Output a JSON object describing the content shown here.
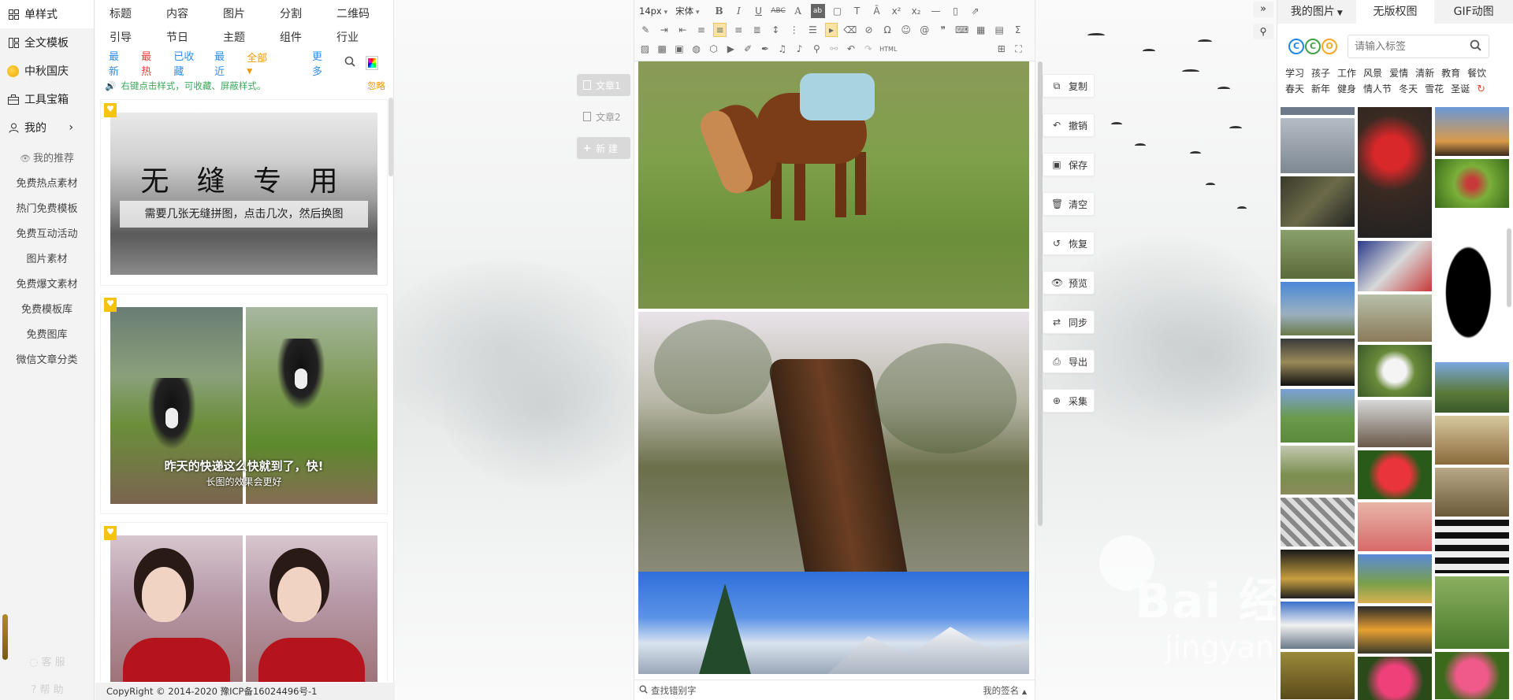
{
  "left_nav": {
    "main": [
      {
        "label": "单样式",
        "icon": "grid-icon",
        "active": true
      },
      {
        "label": "全文模板",
        "icon": "template-icon"
      },
      {
        "label": "中秋国庆",
        "icon": "moon-icon"
      },
      {
        "label": "工具宝箱",
        "icon": "toolbox-icon"
      },
      {
        "label": "我的",
        "icon": "user-icon"
      }
    ],
    "sub": [
      "我的推荐",
      "免费热点素材",
      "热门免费模板",
      "免费互动活动",
      "图片素材",
      "免费爆文素材",
      "免费模板库",
      "免费图库",
      "微信文章分类"
    ],
    "bottom": [
      "客 服",
      "帮 助"
    ]
  },
  "categories": {
    "row1": [
      "标题",
      "内容",
      "图片",
      "分割",
      "二维码"
    ],
    "row2": [
      "引导",
      "节日",
      "主题",
      "组件",
      "行业"
    ]
  },
  "filters": [
    {
      "label": "最新",
      "color": "#2d8ef0"
    },
    {
      "label": "最热",
      "color": "#e6443b"
    },
    {
      "label": "已收藏",
      "color": "#2d8ef0"
    },
    {
      "label": "最近",
      "color": "#2d8ef0"
    },
    {
      "label": "全部",
      "color": "#f39800"
    },
    {
      "label": "更多",
      "color": "#2d8ef0"
    }
  ],
  "hint": {
    "text": "右键点击样式，可收藏、屏蔽样式。",
    "ignore": "忽略"
  },
  "templates": [
    {
      "title": "无 缝 专 用",
      "subtitle": "需要几张无缝拼图，点击几次，然后换图"
    },
    {
      "caption1": "昨天的快递这么快就到了，快!",
      "caption2": "长图的效果会更好"
    },
    {}
  ],
  "copyright": "CopyRight © 2014-2020 豫ICP备16024496号-1",
  "doc_tabs": [
    {
      "label": "文章1",
      "active": true
    },
    {
      "label": "文章2"
    },
    {
      "label": "新 建"
    }
  ],
  "toolbar": {
    "font_size": "14px",
    "font_family": "宋体",
    "html_label": "HTML"
  },
  "editor_footer": {
    "find_label": "查找错别字",
    "signature_label": "我的签名"
  },
  "actions": [
    {
      "label": "复制",
      "icon": "copy-icon"
    },
    {
      "label": "撤销",
      "icon": "undo-icon"
    },
    {
      "label": "保存",
      "icon": "save-icon"
    },
    {
      "label": "清空",
      "icon": "trash-icon"
    },
    {
      "label": "恢复",
      "icon": "restore-icon"
    },
    {
      "label": "预览",
      "icon": "eye-icon"
    },
    {
      "label": "同步",
      "icon": "sync-icon"
    },
    {
      "label": "导出",
      "icon": "export-icon"
    },
    {
      "label": "采集",
      "icon": "collect-icon"
    }
  ],
  "image_panel": {
    "tabs": [
      "我的图片",
      "无版权图",
      "GIF动图"
    ],
    "active_tab": "无版权图",
    "cco": [
      "C",
      "C",
      "O"
    ],
    "search_placeholder": "请输入标签",
    "tags_row1": [
      "学习",
      "孩子",
      "工作",
      "风景",
      "爱情",
      "清新",
      "教育",
      "餐饮"
    ],
    "tags_row2": [
      "春天",
      "新年",
      "健身",
      "情人节",
      "冬天",
      "雪花",
      "圣诞"
    ]
  },
  "watermark": {
    "text": "Bai 经验",
    "url": "jingyan.baidu.com"
  }
}
